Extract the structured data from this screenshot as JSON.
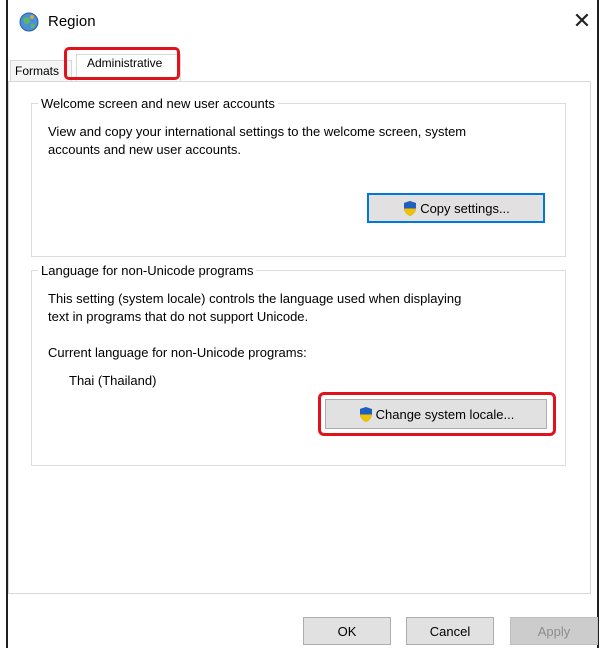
{
  "window": {
    "title": "Region",
    "close_glyph": "✕",
    "app_icon": "globe-icon"
  },
  "tabs": [
    {
      "label": "Formats",
      "active": false
    },
    {
      "label": "Administrative",
      "active": true
    }
  ],
  "welcome_group": {
    "legend": "Welcome screen and new user accounts",
    "line1": "View and copy your international settings to the welcome screen, system",
    "line2": "accounts and new user accounts.",
    "button_label": "Copy settings..."
  },
  "language_group": {
    "legend": "Language for non-Unicode programs",
    "line1": "This setting (system locale) controls the language used when displaying",
    "line2": "text in programs that do not support Unicode.",
    "current_label": "Current language for non-Unicode programs:",
    "current_value": "Thai (Thailand)",
    "button_label": "Change system locale..."
  },
  "footer": {
    "ok_label": "OK",
    "cancel_label": "Cancel",
    "apply_label": "Apply"
  },
  "colors": {
    "highlight": "#e0131d",
    "focus_border": "#0078d7",
    "shield_blue": "#1f5fbf",
    "shield_yellow": "#f2c200"
  }
}
